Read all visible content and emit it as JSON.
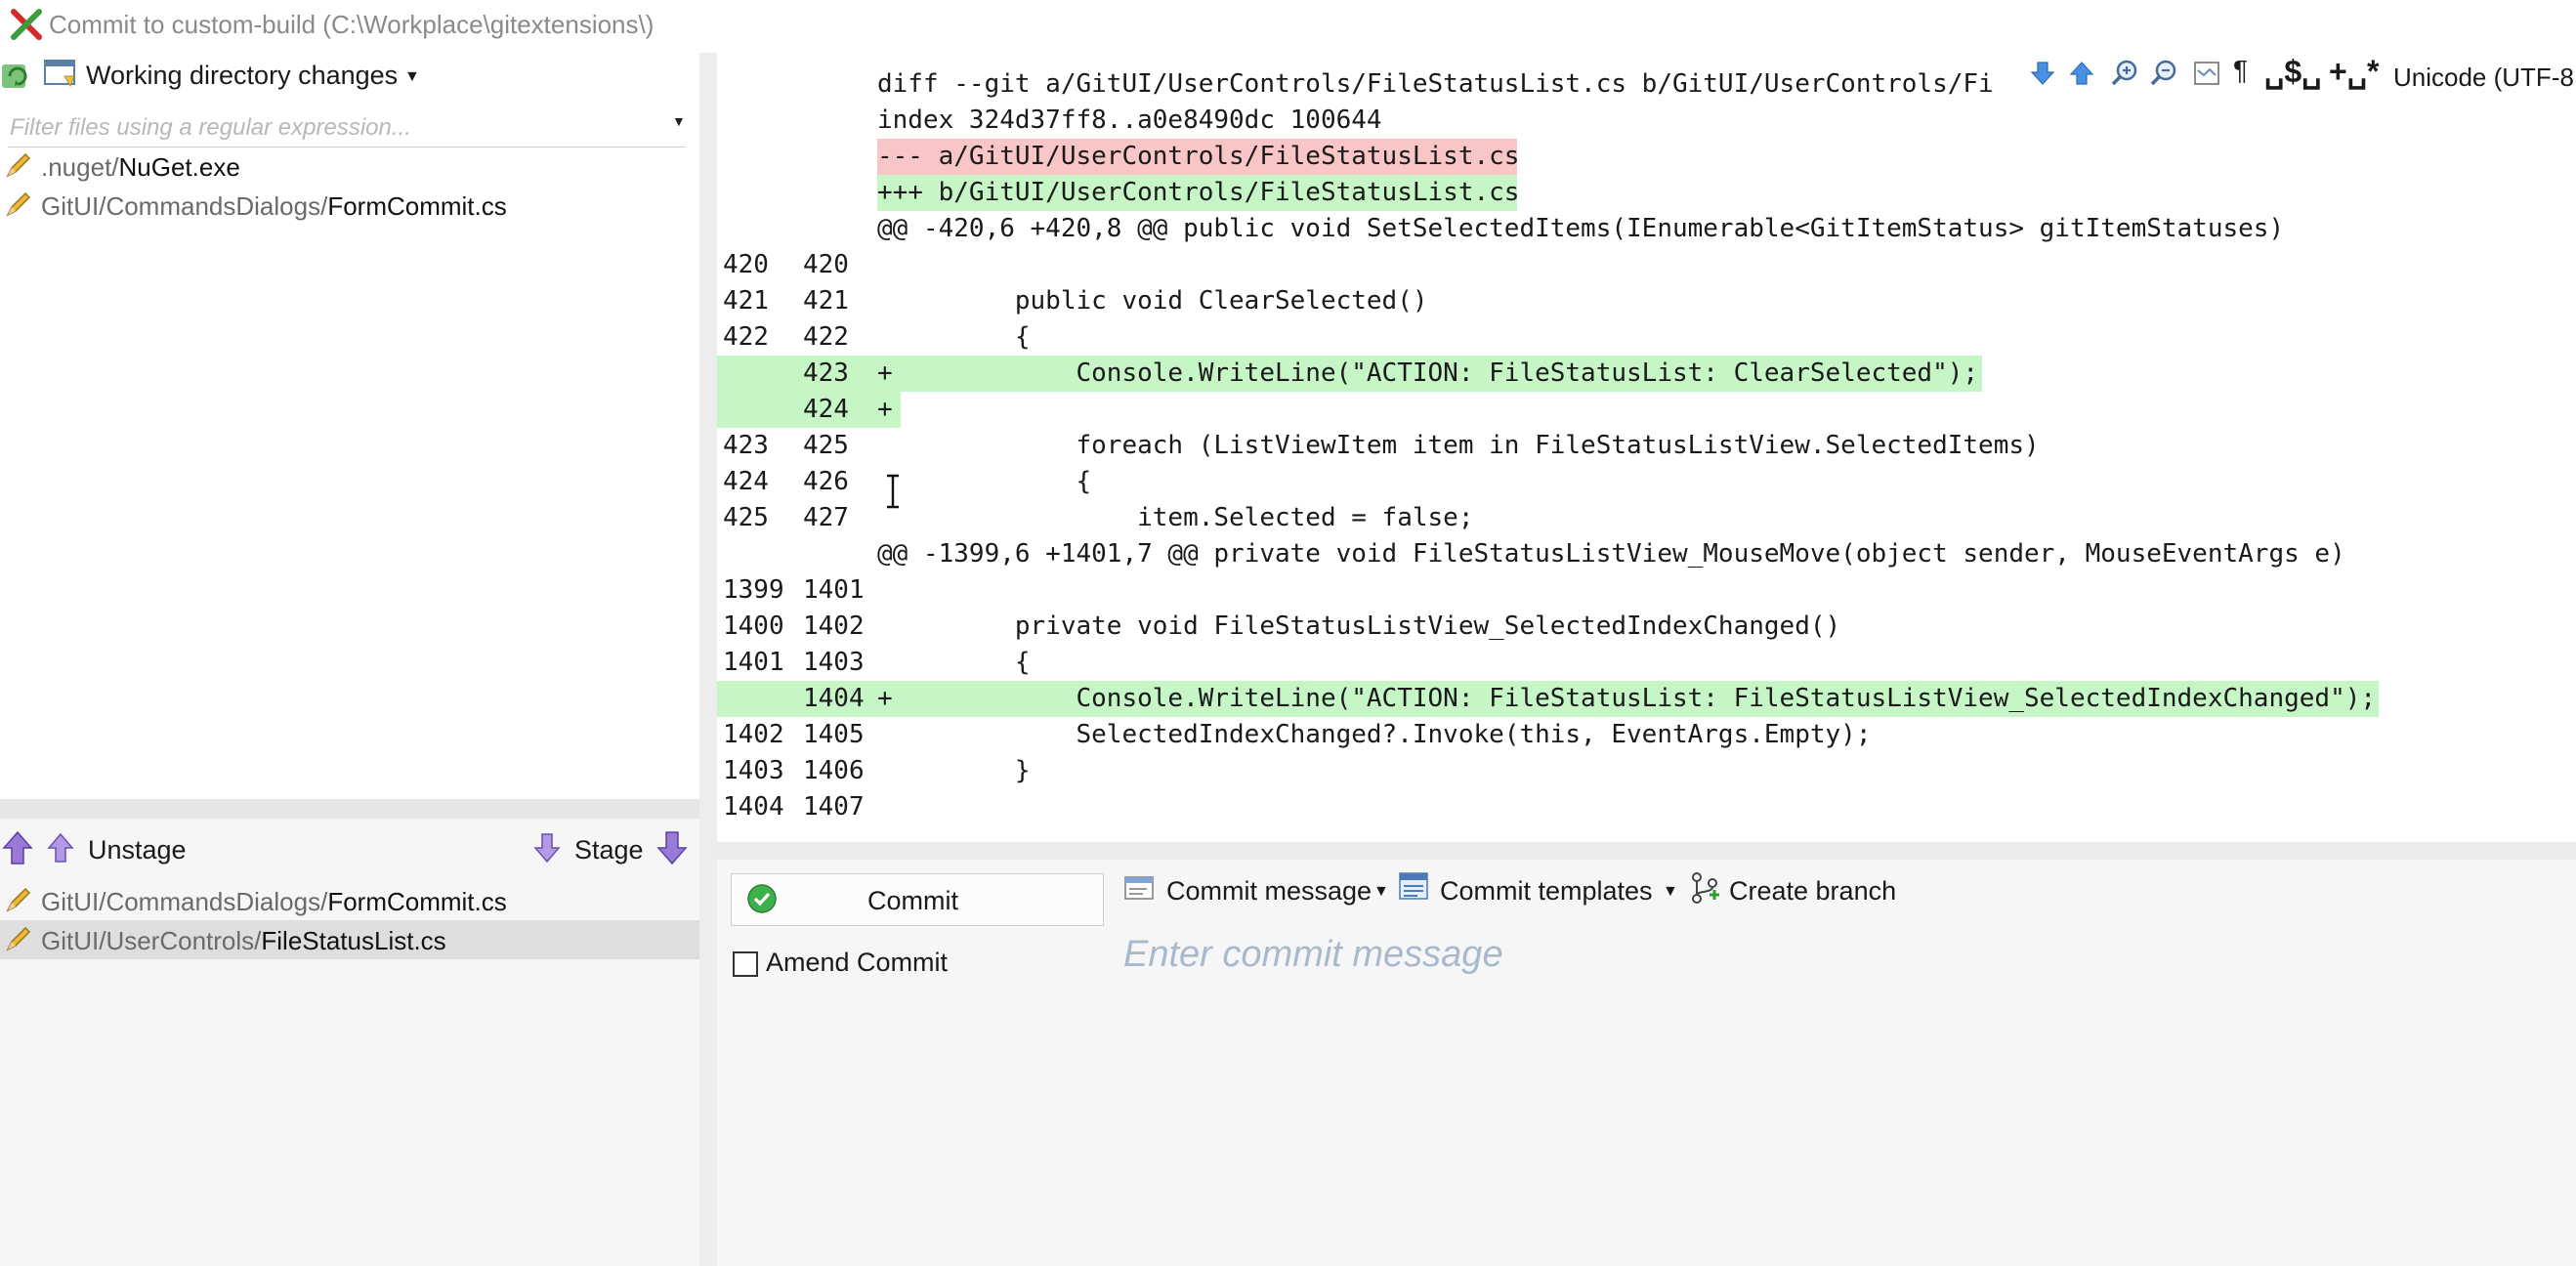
{
  "window": {
    "title": "Commit to custom-build (C:\\Workplace\\gitextensions\\)"
  },
  "unstaged": {
    "dropdown_label": "Working directory changes",
    "filter_placeholder": "Filter files using a regular expression...",
    "files": [
      {
        "dir": ".nuget/",
        "name": "NuGet.exe"
      },
      {
        "dir": "GitUI/CommandsDialogs/",
        "name": "FormCommit.cs"
      }
    ]
  },
  "staging_toolbar": {
    "unstage_label": "Unstage",
    "stage_label": "Stage"
  },
  "staged": {
    "files": [
      {
        "dir": "GitUI/CommandsDialogs/",
        "name": "FormCommit.cs",
        "selected": false
      },
      {
        "dir": "GitUI/UserControls/",
        "name": "FileStatusList.cs",
        "selected": true
      }
    ]
  },
  "diff_toolbar": {
    "encoding": "Unicode (UTF-8",
    "icons": [
      "next-change-icon",
      "previous-change-icon",
      "zoom-in-icon",
      "zoom-out-icon",
      "show-entire-file-icon",
      "show-nonprinting-icon",
      "show-whitespace-icon",
      "ignore-whitespace-icon"
    ]
  },
  "diff": {
    "lines": [
      {
        "ln1": "",
        "ln2": "",
        "text": "diff --git a/GitUI/UserControls/FileStatusList.cs b/GitUI/UserControls/Fi",
        "kind": "header"
      },
      {
        "ln1": "",
        "ln2": "",
        "text": "index 324d37ff8..a0e8490dc 100644",
        "kind": "header"
      },
      {
        "ln1": "",
        "ln2": "",
        "text": "--- a/GitUI/UserControls/FileStatusList.cs",
        "kind": "del"
      },
      {
        "ln1": "",
        "ln2": "",
        "text": "+++ b/GitUI/UserControls/FileStatusList.cs",
        "kind": "add"
      },
      {
        "ln1": "",
        "ln2": "",
        "text": "@@ -420,6 +420,8 @@ public void SetSelectedItems(IEnumerable<GitItemStatus> gitItemStatuses)",
        "kind": "hunk"
      },
      {
        "ln1": "420",
        "ln2": "420",
        "text": "",
        "kind": "ctx"
      },
      {
        "ln1": "421",
        "ln2": "421",
        "text": "         public void ClearSelected()",
        "kind": "ctx"
      },
      {
        "ln1": "422",
        "ln2": "422",
        "text": "         {",
        "kind": "ctx"
      },
      {
        "ln1": "",
        "ln2": "423",
        "text": "+            Console.WriteLine(\"ACTION: FileStatusList: ClearSelected\");",
        "kind": "addline"
      },
      {
        "ln1": "",
        "ln2": "424",
        "text": "+",
        "kind": "addline"
      },
      {
        "ln1": "423",
        "ln2": "425",
        "text": "             foreach (ListViewItem item in FileStatusListView.SelectedItems)",
        "kind": "ctx"
      },
      {
        "ln1": "424",
        "ln2": "426",
        "text": "             {",
        "kind": "ctx"
      },
      {
        "ln1": "425",
        "ln2": "427",
        "text": "                 item.Selected = false;",
        "kind": "ctx"
      },
      {
        "ln1": "",
        "ln2": "",
        "text": "@@ -1399,6 +1401,7 @@ private void FileStatusListView_MouseMove(object sender, MouseEventArgs e)",
        "kind": "hunk"
      },
      {
        "ln1": "1399",
        "ln2": "1401",
        "text": "",
        "kind": "ctx"
      },
      {
        "ln1": "1400",
        "ln2": "1402",
        "text": "         private void FileStatusListView_SelectedIndexChanged()",
        "kind": "ctx"
      },
      {
        "ln1": "1401",
        "ln2": "1403",
        "text": "         {",
        "kind": "ctx"
      },
      {
        "ln1": "",
        "ln2": "1404",
        "text": "+            Console.WriteLine(\"ACTION: FileStatusList: FileStatusListView_SelectedIndexChanged\");",
        "kind": "addline"
      },
      {
        "ln1": "1402",
        "ln2": "1405",
        "text": "             SelectedIndexChanged?.Invoke(this, EventArgs.Empty);",
        "kind": "ctx"
      },
      {
        "ln1": "1403",
        "ln2": "1406",
        "text": "         }",
        "kind": "ctx"
      },
      {
        "ln1": "1404",
        "ln2": "1407",
        "text": "",
        "kind": "ctx"
      }
    ]
  },
  "commit": {
    "commit_button": "Commit",
    "amend_label": "Amend Commit",
    "amend_checked": false,
    "commit_message_menu": "Commit message",
    "commit_templates_menu": "Commit templates",
    "create_branch_label": "Create branch",
    "message_placeholder": "Enter commit message",
    "message_value": ""
  },
  "colors": {
    "added_line": "#c6f5c6",
    "deleted_line": "#f8c6c6",
    "placeholder": "#a9b9cd"
  }
}
